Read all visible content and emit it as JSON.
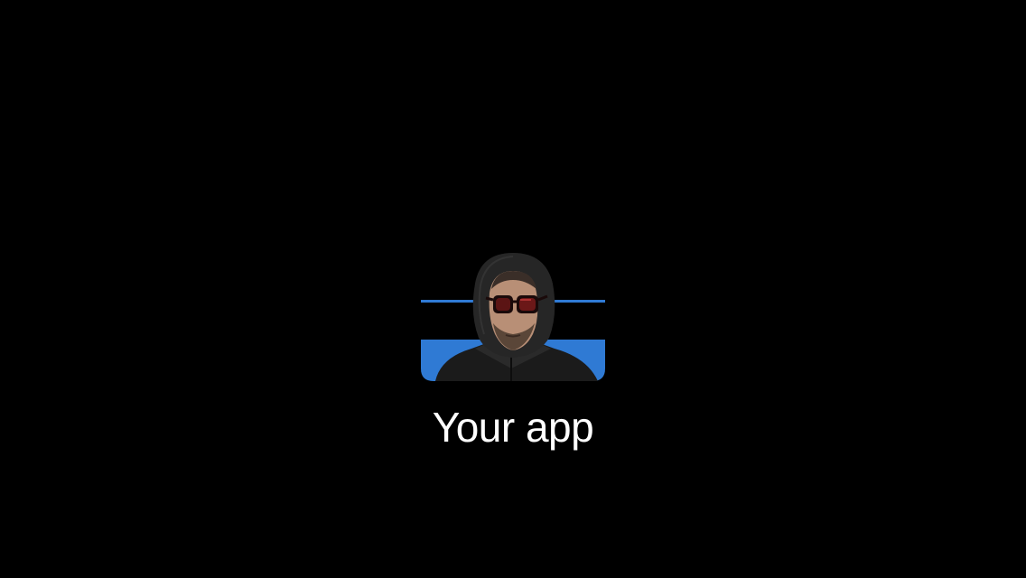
{
  "caption": "Your app",
  "logo": {
    "icon": "person-in-hood-with-sunglasses-on-blue-stripes",
    "accent_color": "#2f7ad4"
  }
}
